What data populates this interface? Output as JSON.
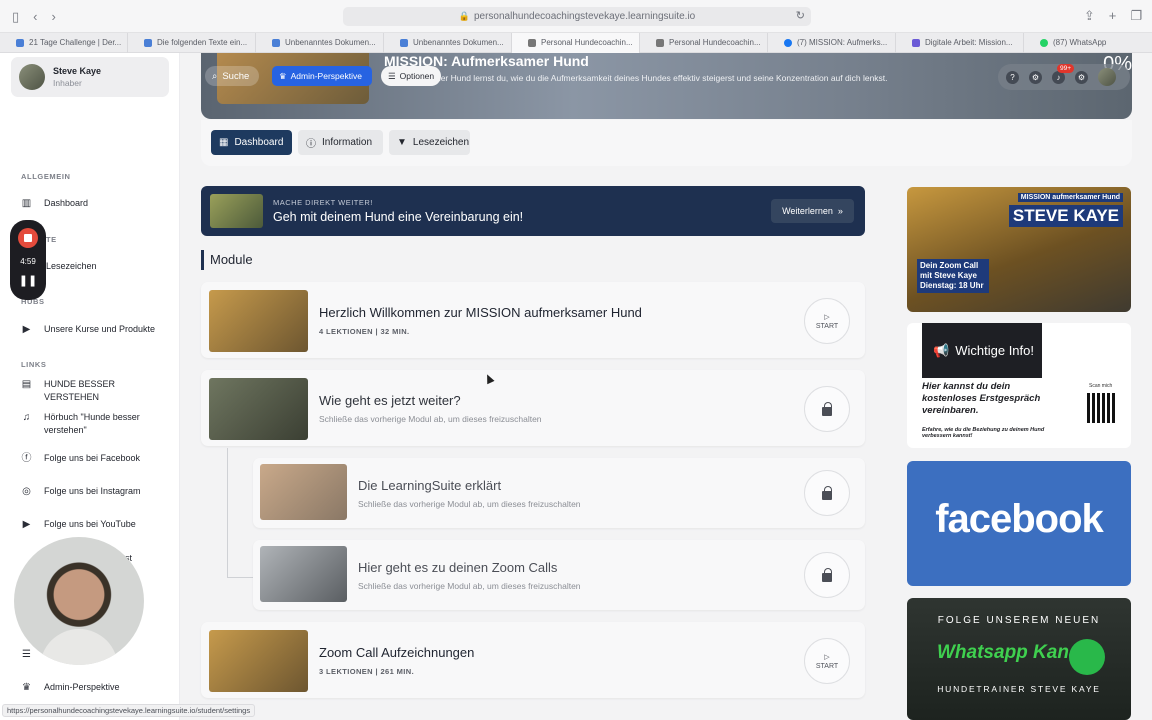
{
  "browser": {
    "url": "personalhundecoachingstevekaye.learningsuite.io",
    "tabs": [
      "21 Tage Challenge | Der...",
      "Die folgenden Texte ein...",
      "Unbenanntes Dokumen...",
      "Unbenanntes Dokumen...",
      "Personal Hundecoachin...",
      "Personal Hundecoachin...",
      "(7) MISSION: Aufmerks...",
      "Digitale Arbeit: Mission...",
      "(87) WhatsApp"
    ],
    "status_url": "https://personalhundecoachingstevekaye.learningsuite.io/student/settings"
  },
  "sidebar": {
    "user": {
      "name": "Steve Kaye",
      "role": "Inhaber"
    },
    "sections": {
      "allgemein": "ALLGEMEIN",
      "lesezeichen_partial": "TE",
      "hubs": "HUBS",
      "links": "LINKS"
    },
    "items": {
      "dashboard": "Dashboard",
      "lesezeichen": "Lesezeichen",
      "kurse": "Unsere Kurse und Produkte",
      "hunde_besser_verstehen": "HUNDE BESSER VERSTEHEN",
      "hoerbuch": "Hörbuch \"Hunde besser verstehen\"",
      "facebook": "Folge uns bei Facebook",
      "instagram": "Folge uns bei Instagram",
      "youtube": "Folge uns bei YouTube",
      "podcast_partial": "ast",
      "admin": "Admin-Perspektive"
    },
    "recorder": {
      "time": "4:59"
    }
  },
  "header": {
    "title": "MISSION: Aufmerksamer Hund",
    "description": "Aufmerksamer Hund lernst du, wie du die Aufmerksamkeit deines Hundes effektiv steigerst und seine Konzentration auf dich lenkst.",
    "desc_prefix": "...",
    "percent": "0%",
    "search_label": "Suche",
    "admin_label": "Admin-Perspektive",
    "options_label": "Optionen",
    "notification_badge": "99+"
  },
  "subtabs": {
    "dashboard": "Dashboard",
    "information": "Information",
    "bookmarks": "Lesezeichen"
  },
  "cta": {
    "eyebrow": "MACHE DIREKT WEITER!",
    "title": "Geh mit deinem Hund eine Vereinbarung ein!",
    "button": "Weiterlernen"
  },
  "modules_title": "Module",
  "modules": [
    {
      "title": "Herzlich Willkommen zur MISSION aufmerksamer Hund",
      "meta": "4 LEKTIONEN | 32 MIN.",
      "action": "START"
    },
    {
      "title": "Wie geht es jetzt weiter?",
      "hint": "Schließe das vorherige Modul ab, um dieses freizuschalten"
    },
    {
      "title": "Die LearningSuite erklärt",
      "hint": "Schließe das vorherige Modul ab, um dieses freizuschalten"
    },
    {
      "title": "Hier geht es zu deinen Zoom Calls",
      "hint": "Schließe das vorherige Modul ab, um dieses freizuschalten"
    },
    {
      "title": "Zoom Call Aufzeichnungen",
      "meta": "3 LEKTIONEN | 261 MIN.",
      "action": "START"
    }
  ],
  "promos": {
    "p1_top": "MISSION aufmerksamer Hund",
    "p1_name": "STEVE KAYE",
    "p1_zoom": "Dein Zoom Call mit Steve Kaye Dienstag: 18 Uhr",
    "p2_head": "Wichtige Info!",
    "p2_body": "Hier kannst du dein kostenloses Erstgespräch vereinbaren.",
    "p2_small": "Erfahre, wie du die Beziehung zu deinem Hund verbessern kannst!",
    "p2_qr": "Scan mich",
    "p3": "facebook",
    "p4_l1": "FOLGE UNSEREM NEUEN",
    "p4_l2": "Whatsapp Kanal",
    "p4_l3": "HUNDETRAINER STEVE KAYE"
  }
}
